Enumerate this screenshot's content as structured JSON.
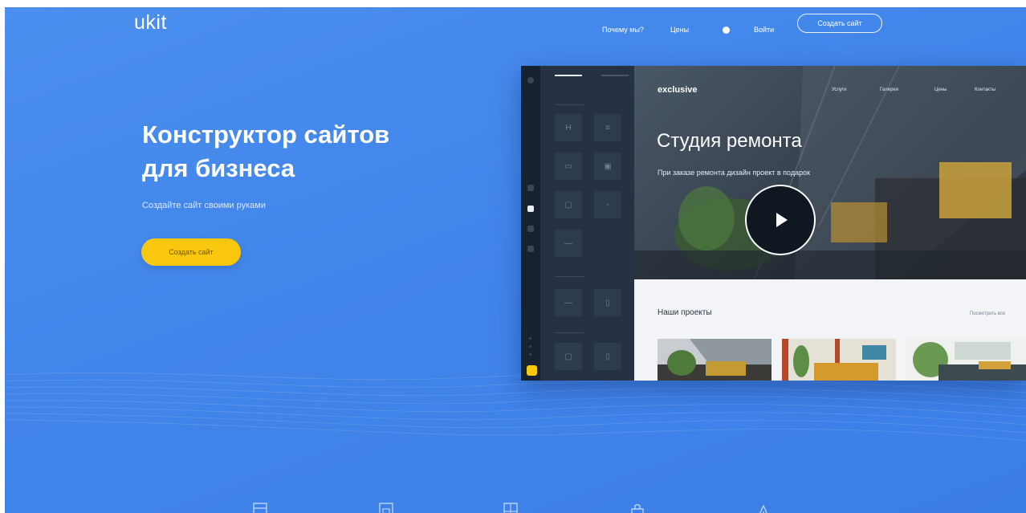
{
  "header": {
    "logo": "ukit",
    "nav": [
      "Почему мы?",
      "Цены",
      "Войти"
    ],
    "cta": "Создать сайт"
  },
  "hero": {
    "title_line1": "Конструктор сайтов",
    "title_line2": "для бизнеса",
    "subtitle": "Создайте сайт своими руками",
    "cta": "Создать сайт"
  },
  "editor": {
    "blocks": [
      "H",
      "≡",
      "▭",
      "▣",
      "▢",
      "◦",
      "—",
      "—",
      "▯",
      "▢",
      "▯"
    ]
  },
  "preview": {
    "brand": "exclusive",
    "nav": [
      "Услуги",
      "Галерея",
      "Цены",
      "Контакты"
    ],
    "title": "Студия ремонта",
    "subtitle": "При заказе ремонта дизайн проект в подарок",
    "projects_title": "Наши проекты",
    "see_all": "Посмотреть все"
  },
  "colors": {
    "hero_blue": "#4285ea",
    "accent_yellow": "#f9c80e",
    "editor_dark": "#1f2a3a"
  },
  "bottom_icons": [
    "layout-icon",
    "image-icon",
    "grid-icon",
    "shopping-bag-icon",
    "warning-icon"
  ]
}
